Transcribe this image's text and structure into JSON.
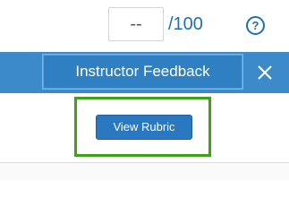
{
  "score": {
    "value": "--",
    "max_label": "/100"
  },
  "help": {
    "symbol": "?"
  },
  "panel": {
    "title": "Instructor Feedback",
    "close_symbol": "✕"
  },
  "actions": {
    "view_rubric_label": "View Rubric"
  },
  "colors": {
    "accent": "#1f6fb8",
    "header_bar": "#3d8acb",
    "button": "#2a78c0",
    "focus_outline": "#3ea21a"
  }
}
